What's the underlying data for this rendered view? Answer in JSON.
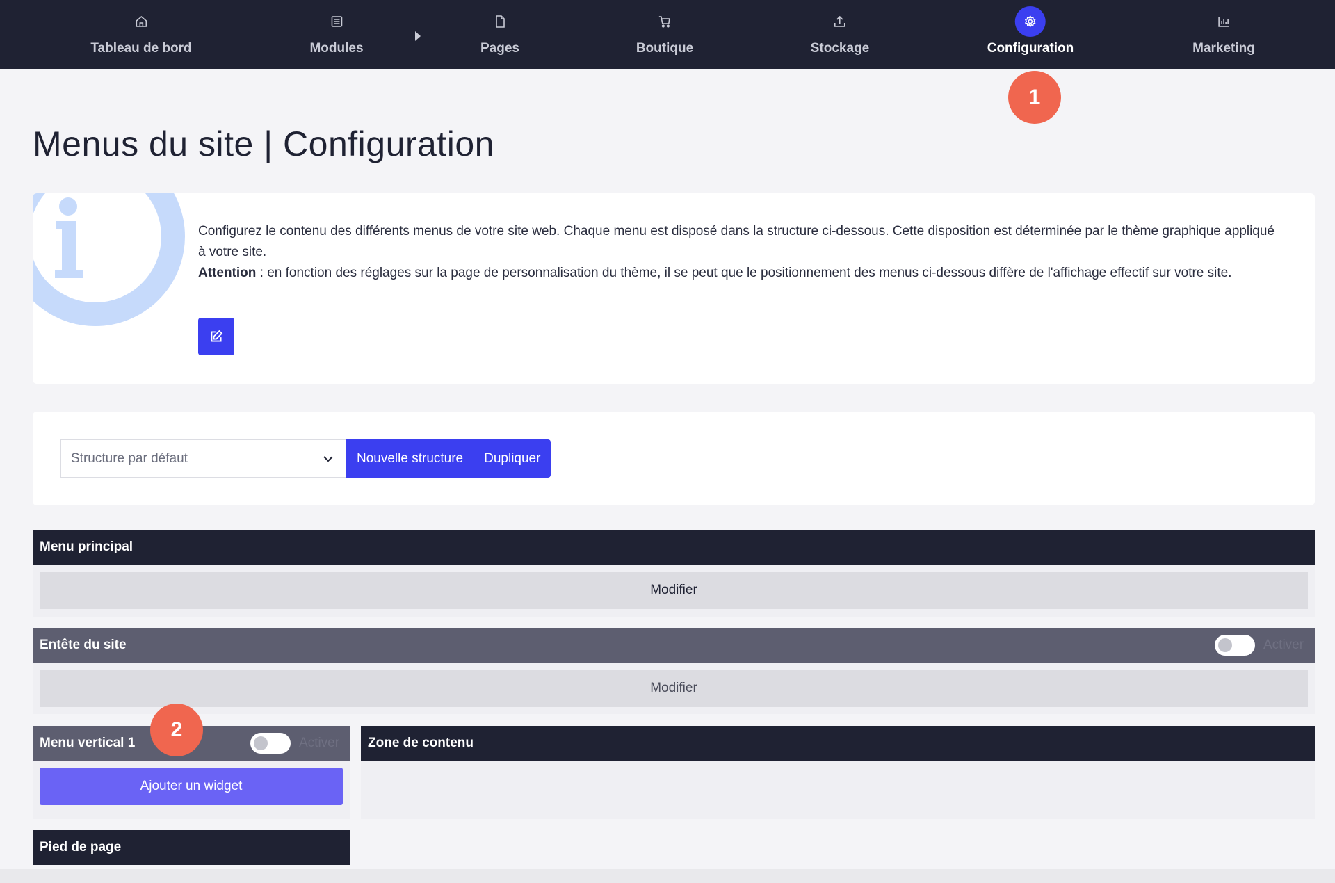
{
  "nav": {
    "items": [
      {
        "label": "Tableau de bord",
        "icon": "home-icon"
      },
      {
        "label": "Modules",
        "icon": "list-icon"
      },
      {
        "label": "Pages",
        "icon": "file-icon"
      },
      {
        "label": "Boutique",
        "icon": "cart-icon"
      },
      {
        "label": "Stockage",
        "icon": "upload-icon"
      },
      {
        "label": "Configuration",
        "icon": "gear-icon",
        "active": true
      },
      {
        "label": "Marketing",
        "icon": "bar-chart-icon"
      }
    ]
  },
  "badges": {
    "one": "1",
    "two": "2"
  },
  "page": {
    "title": "Menus du site | Configuration"
  },
  "info": {
    "line1": "Configurez le contenu des différents menus de votre site web. Chaque menu est disposé dans la structure ci-dessous. Cette disposition est déterminée par le thème graphique appliqué à votre site.",
    "attention_label": "Attention",
    "attention_text": " : en fonction des réglages sur la page de personnalisation du thème, il se peut que le positionnement des menus ci-dessous diffère de l'affichage effectif sur votre site."
  },
  "structure": {
    "selected": "Structure par défaut",
    "new_label": "Nouvelle structure",
    "duplicate_label": "Dupliquer"
  },
  "sections": {
    "main_menu": {
      "title": "Menu principal",
      "button": "Modifier"
    },
    "header": {
      "title": "Entête du site",
      "toggle_label": "Activer",
      "button": "Modifier"
    },
    "vertical_menu": {
      "title": "Menu vertical 1",
      "toggle_label": "Activer",
      "button": "Ajouter un widget"
    },
    "content_zone": {
      "title": "Zone de contenu"
    },
    "footer": {
      "title": "Pied de page"
    }
  },
  "colors": {
    "nav_bg": "#1f2233",
    "accent": "#3b3ff0",
    "badge": "#f0664f",
    "widget_button": "#6a63f5",
    "section_gray": "#5d5e70",
    "info_graphic": "#c6dafb"
  }
}
